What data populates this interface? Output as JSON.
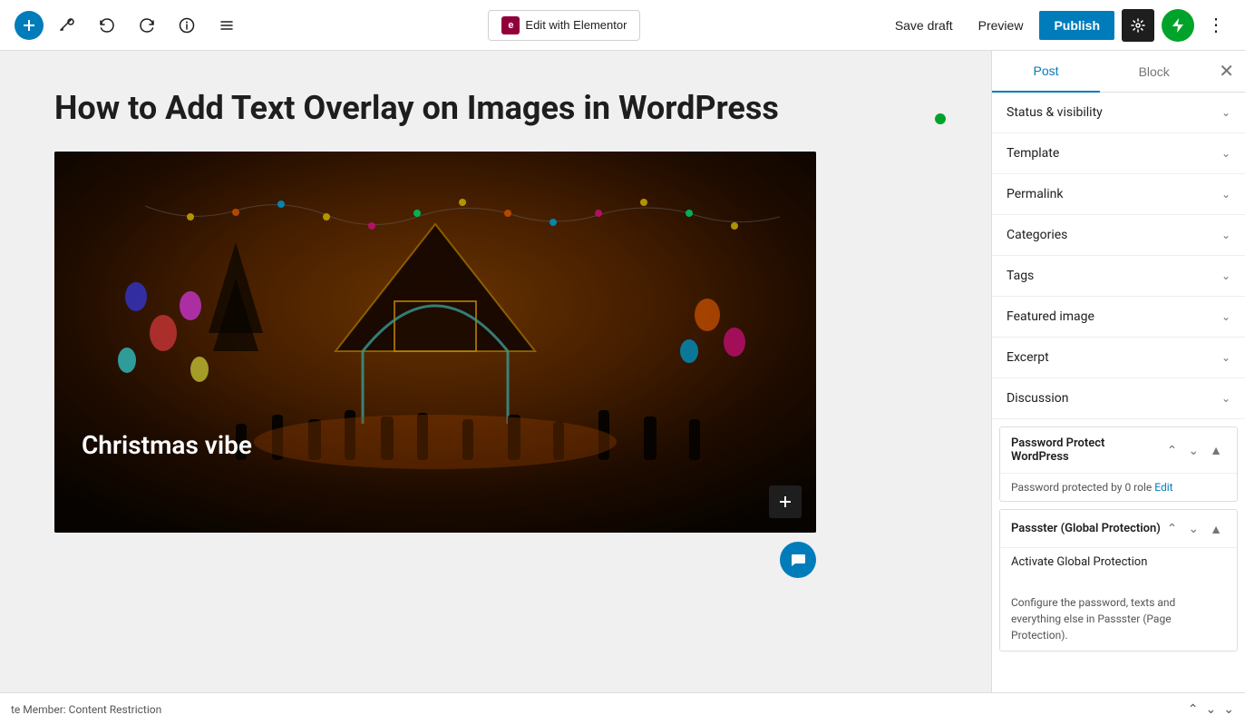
{
  "toolbar": {
    "add_label": "+",
    "edit_elementor_label": "Edit with Elementor",
    "elementor_icon": "e",
    "save_draft_label": "Save draft",
    "preview_label": "Preview",
    "publish_label": "Publish",
    "more_label": "⋮"
  },
  "editor": {
    "title": "How to Add Text Overlay on Images in WordPress",
    "image_caption": "Christmas vibe"
  },
  "sidebar": {
    "tab_post_label": "Post",
    "tab_block_label": "Block",
    "sections": [
      {
        "label": "Status & visibility"
      },
      {
        "label": "Template"
      },
      {
        "label": "Permalink"
      },
      {
        "label": "Categories"
      },
      {
        "label": "Tags"
      },
      {
        "label": "Featured image"
      },
      {
        "label": "Excerpt"
      },
      {
        "label": "Discussion"
      }
    ],
    "password_protect": {
      "title": "Password Protect WordPress",
      "body_text": "Password protected by 0 role",
      "edit_label": "Edit"
    },
    "passster": {
      "title": "Passster (Global Protection)",
      "activate_label": "Activate Global Protection",
      "configure_text": "Configure the password, texts and everything else in Passster (Page Protection)."
    }
  },
  "bottom_bar": {
    "text": "te Member: Content Restriction"
  }
}
